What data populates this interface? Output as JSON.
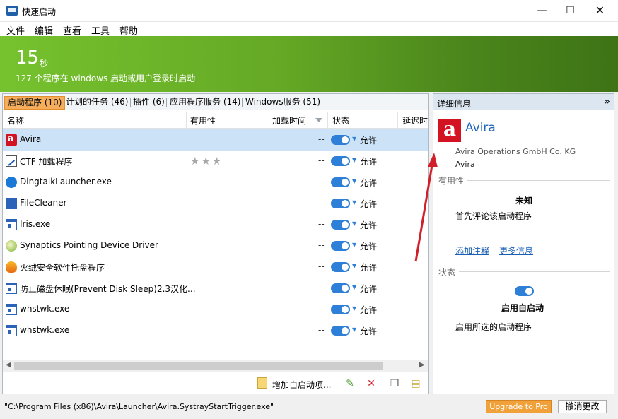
{
  "window": {
    "title": "快速启动",
    "controls": {
      "minimize": "—",
      "maximize": "☐",
      "close": "✕"
    }
  },
  "menu": [
    "文件",
    "编辑",
    "查看",
    "工具",
    "帮助"
  ],
  "banner": {
    "seconds": "15",
    "unit": "秒",
    "description": "127 个程序在 windows 启动或用户登录时启动"
  },
  "tabs": [
    {
      "label": "启动程序 (10)",
      "active": true
    },
    {
      "label": "计划的任务 (46)"
    },
    {
      "label": "插件 (6)"
    },
    {
      "label": "应用程序服务 (14)"
    },
    {
      "label": "Windows服务 (51)"
    }
  ],
  "columns": [
    "名称",
    "有用性",
    "加载时间",
    "状态",
    "延迟时"
  ],
  "rows": [
    {
      "icon": "avira-icon",
      "name": "Avira",
      "stars": "",
      "time": "--",
      "status": "允许",
      "selected": true
    },
    {
      "icon": "ctf-loader-icon",
      "name": "CTF 加载程序",
      "stars": "★★★",
      "time": "--",
      "status": "允许"
    },
    {
      "icon": "dingtalk-icon",
      "name": "DingtalkLauncher.exe",
      "stars": "",
      "time": "--",
      "status": "允许"
    },
    {
      "icon": "filecleaner-icon",
      "name": "FileCleaner",
      "stars": "",
      "time": "--",
      "status": "允许"
    },
    {
      "icon": "window-app-icon",
      "name": "Iris.exe",
      "stars": "",
      "time": "--",
      "status": "允许"
    },
    {
      "icon": "synaptics-icon",
      "name": "Synaptics Pointing Device Driver",
      "stars": "",
      "time": "--",
      "status": "允许"
    },
    {
      "icon": "huorong-icon",
      "name": "火绒安全软件托盘程序",
      "stars": "",
      "time": "--",
      "status": "允许"
    },
    {
      "icon": "window-app-icon",
      "name": "防止磁盘休眠(Prevent Disk Sleep)2.3汉化...",
      "stars": "",
      "time": "--",
      "status": "允许"
    },
    {
      "icon": "window-app-icon",
      "name": "whstwk.exe",
      "stars": "",
      "time": "--",
      "status": "允许"
    },
    {
      "icon": "window-app-icon",
      "name": "whstwk.exe",
      "stars": "",
      "time": "--",
      "status": "允许"
    }
  ],
  "toolbar": {
    "add_label": "增加自启动项...",
    "icons": [
      "edit-check-icon",
      "delete-icon",
      "properties-icon",
      "folder-icon"
    ]
  },
  "details": {
    "header": "详细信息",
    "collapse": "»",
    "app_name": "Avira",
    "company": "Avira Operations GmbH  Co. KG",
    "product": "Avira",
    "usefulness_section": "有用性",
    "usefulness_value": "未知",
    "usefulness_prompt": "首先评论该启动程序",
    "add_comment_link": "添加注释",
    "more_info_link": "更多信息",
    "status_section": "状态",
    "status_value": "启用自启动",
    "status_desc": "启用所选的启动程序"
  },
  "statusbar": {
    "path": "\"C:\\Program Files (x86)\\Avira\\Launcher\\Avira.SystrayStartTrigger.exe\"",
    "upgrade": "Upgrade to Pro",
    "undo": "撤消更改"
  },
  "colors": {
    "accent": "#2e7fd8",
    "banner": "#65a925",
    "tab_active": "#f6ae5c",
    "upgrade": "#f0a13a",
    "arrow": "#d0202a"
  }
}
